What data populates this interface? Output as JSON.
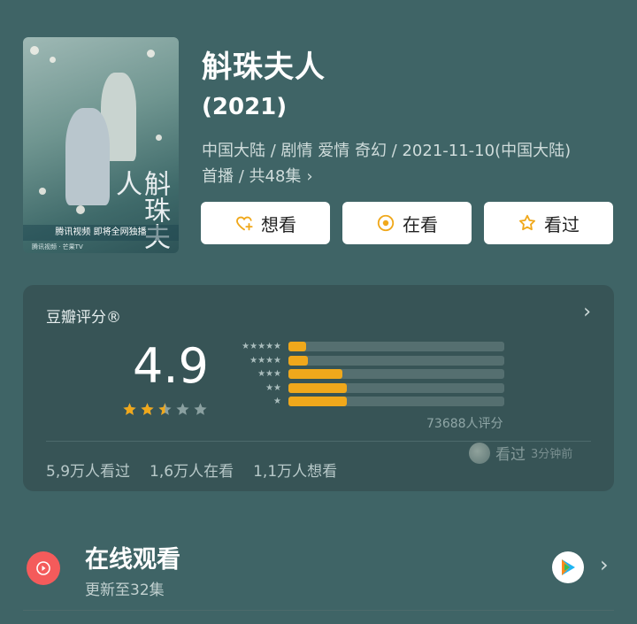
{
  "poster": {
    "title_art": "斛珠夫人",
    "caption": "腾讯视频 即将全网独播",
    "logos": "腾讯视频 · 芒果TV"
  },
  "movie": {
    "title": "斛珠夫人",
    "year": "(2021)",
    "meta_line1": "中国大陆 / 剧情 爱情 奇幻 / 2021-11-10(中国大陆)",
    "meta_line2": "首播 / 共48集"
  },
  "actions": {
    "want": "想看",
    "watching": "在看",
    "watched": "看过"
  },
  "rating": {
    "header": "豆瓣评分®",
    "score": "4.9",
    "stars_value": 2.5,
    "stars_max": 5,
    "distribution": [
      {
        "label": "★★★★★",
        "fraction": 0.08
      },
      {
        "label": "★★★★",
        "fraction": 0.09
      },
      {
        "label": "★★★",
        "fraction": 0.25
      },
      {
        "label": "★★",
        "fraction": 0.27
      },
      {
        "label": "★",
        "fraction": 0.27
      }
    ],
    "count": "73688人评分",
    "stats": [
      "5,9万人看过",
      "1,6万人在看",
      "1,1万人想看"
    ],
    "friend_action": "看过",
    "friend_time": "3分钟前"
  },
  "watch": {
    "title": "在线观看",
    "subtitle": "更新至32集"
  },
  "colors": {
    "background": "#3f6466",
    "card": "#375456",
    "accent": "#f0a81b",
    "play": "#f45b5b"
  }
}
